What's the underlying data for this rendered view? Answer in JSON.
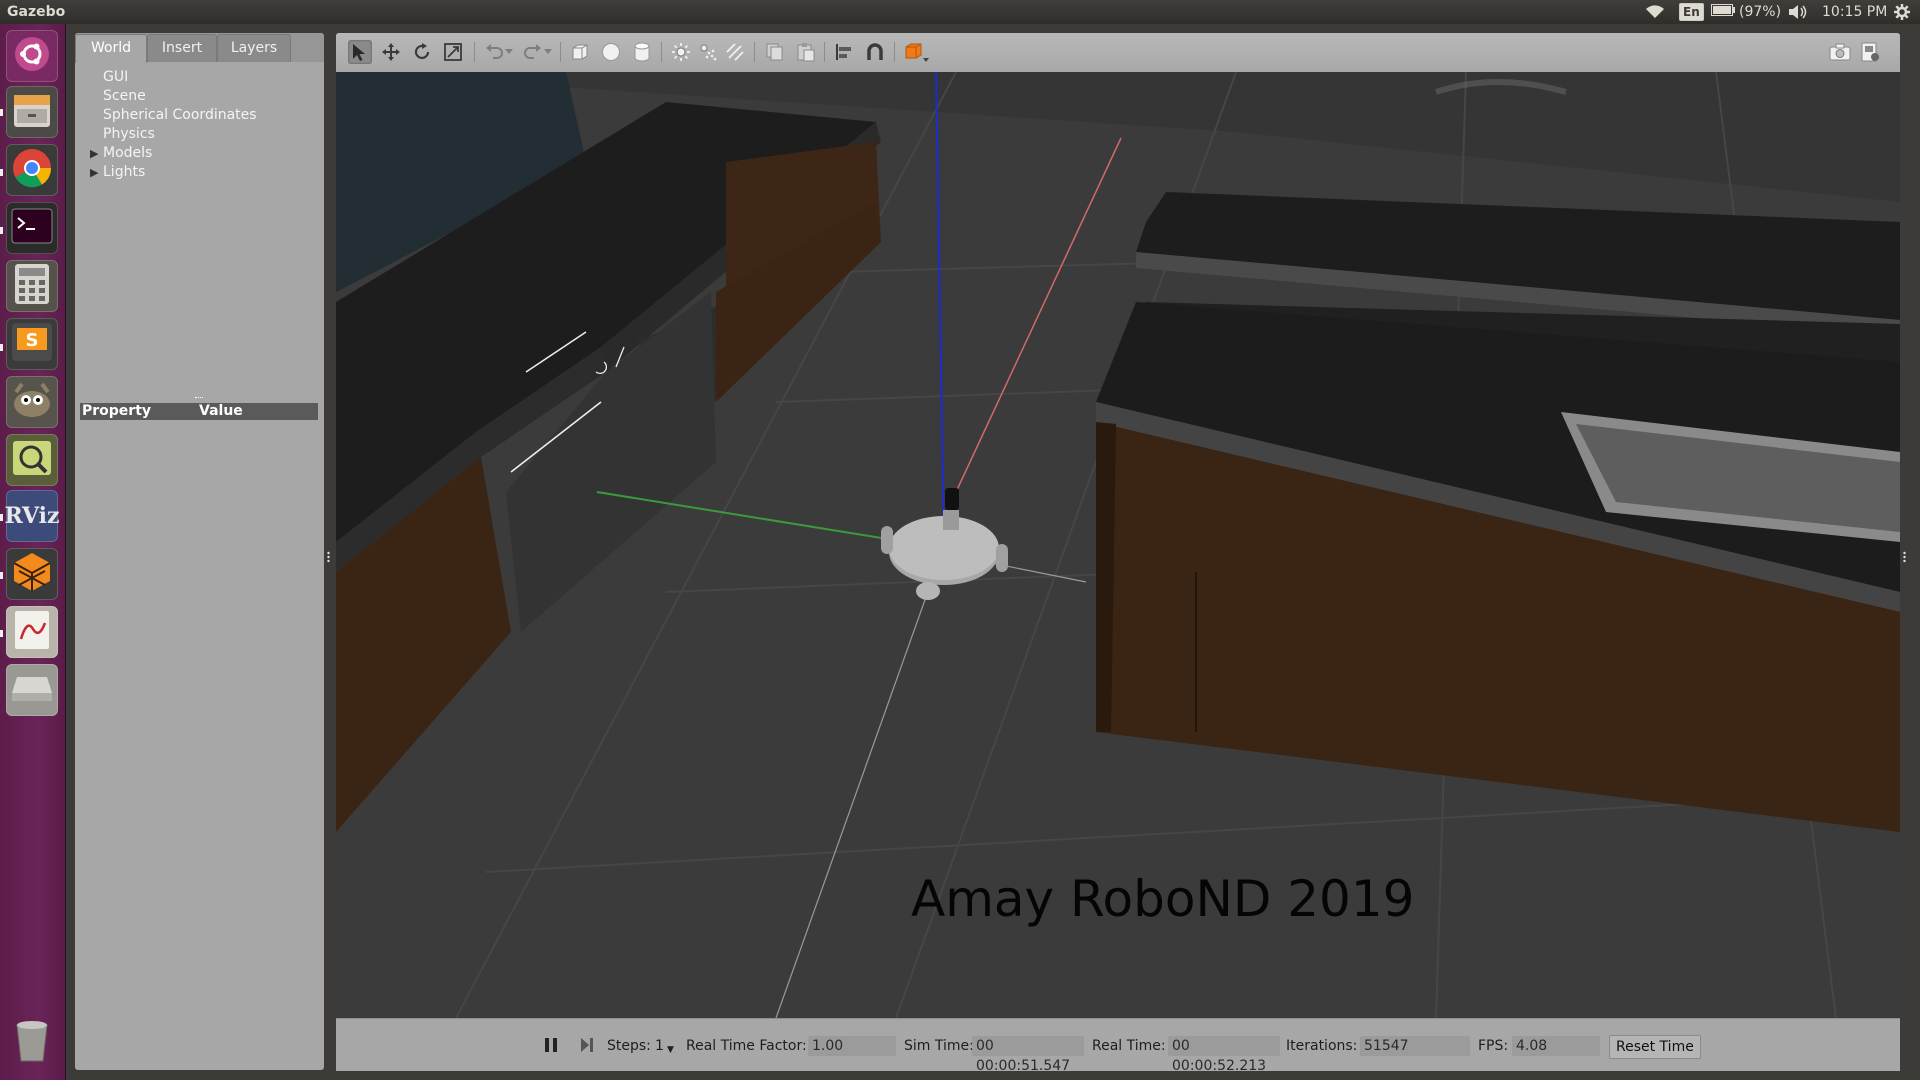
{
  "topbar": {
    "app_title": "Gazebo",
    "keyboard_layout": "En",
    "battery": "(97%)",
    "clock": "10:15 PM",
    "icons": [
      "wifi-icon",
      "keyboard-indicator",
      "battery-icon",
      "volume-icon",
      "power-settings-icon"
    ]
  },
  "launcher": {
    "items": [
      {
        "name": "ubuntu-dash",
        "icon": "ubuntu-logo-icon"
      },
      {
        "name": "files",
        "icon": "file-cabinet-icon"
      },
      {
        "name": "chrome",
        "icon": "chrome-icon"
      },
      {
        "name": "terminal",
        "icon": "terminal-icon"
      },
      {
        "name": "calculator",
        "icon": "calculator-icon"
      },
      {
        "name": "sublime-text",
        "icon": "sublime-text-icon"
      },
      {
        "name": "gimp",
        "icon": "gimp-icon"
      },
      {
        "name": "image-viewer",
        "icon": "image-viewer-icon"
      },
      {
        "name": "rviz",
        "icon": "rviz-icon",
        "label": "RViz"
      },
      {
        "name": "gazebo",
        "icon": "gazebo-icon"
      },
      {
        "name": "pdf-viewer",
        "icon": "pdf-icon"
      },
      {
        "name": "drive",
        "icon": "drive-icon"
      },
      {
        "name": "trash",
        "icon": "trash-icon"
      }
    ]
  },
  "leftpanel": {
    "tabs": [
      {
        "label": "World",
        "active": true
      },
      {
        "label": "Insert",
        "active": false
      },
      {
        "label": "Layers",
        "active": false
      }
    ],
    "tree": [
      {
        "label": "GUI",
        "expandable": false
      },
      {
        "label": "Scene",
        "expandable": false
      },
      {
        "label": "Spherical Coordinates",
        "expandable": false
      },
      {
        "label": "Physics",
        "expandable": false
      },
      {
        "label": "Models",
        "expandable": true
      },
      {
        "label": "Lights",
        "expandable": true
      }
    ],
    "property_header": {
      "property": "Property",
      "value": "Value"
    }
  },
  "toolbar": {
    "tools": [
      "select-arrow-icon",
      "translate-icon",
      "rotate-icon",
      "scale-icon",
      "undo-icon",
      "redo-icon",
      "box-icon",
      "sphere-icon",
      "cylinder-icon",
      "point-light-icon",
      "spot-light-icon",
      "directional-light-icon",
      "copy-icon",
      "paste-icon",
      "align-icon",
      "snap-icon",
      "view-angle-icon",
      "screenshot-icon",
      "record-icon"
    ]
  },
  "viewport": {
    "watermark": "Amay RoboND 2019",
    "colors": {
      "floor": "#3d3d3d",
      "counter_top": "#1f1f1f",
      "cabinet": "#3a2414",
      "axis_x": "#d06a6a",
      "axis_y": "#3c9a3c",
      "axis_z": "#1e2bd0",
      "robot": "#bdbdbd"
    }
  },
  "statusbar": {
    "steps_label": "Steps:",
    "steps_value": "1",
    "rtf_label": "Real Time Factor:",
    "rtf_value": "1.00",
    "sim_time_label": "Sim Time:",
    "sim_time_value": "00 00:00:51.547",
    "real_time_label": "Real Time:",
    "real_time_value": "00 00:00:52.213",
    "iterations_label": "Iterations:",
    "iterations_value": "51547",
    "fps_label": "FPS:",
    "fps_value": "4.08",
    "reset_label": "Reset Time"
  }
}
